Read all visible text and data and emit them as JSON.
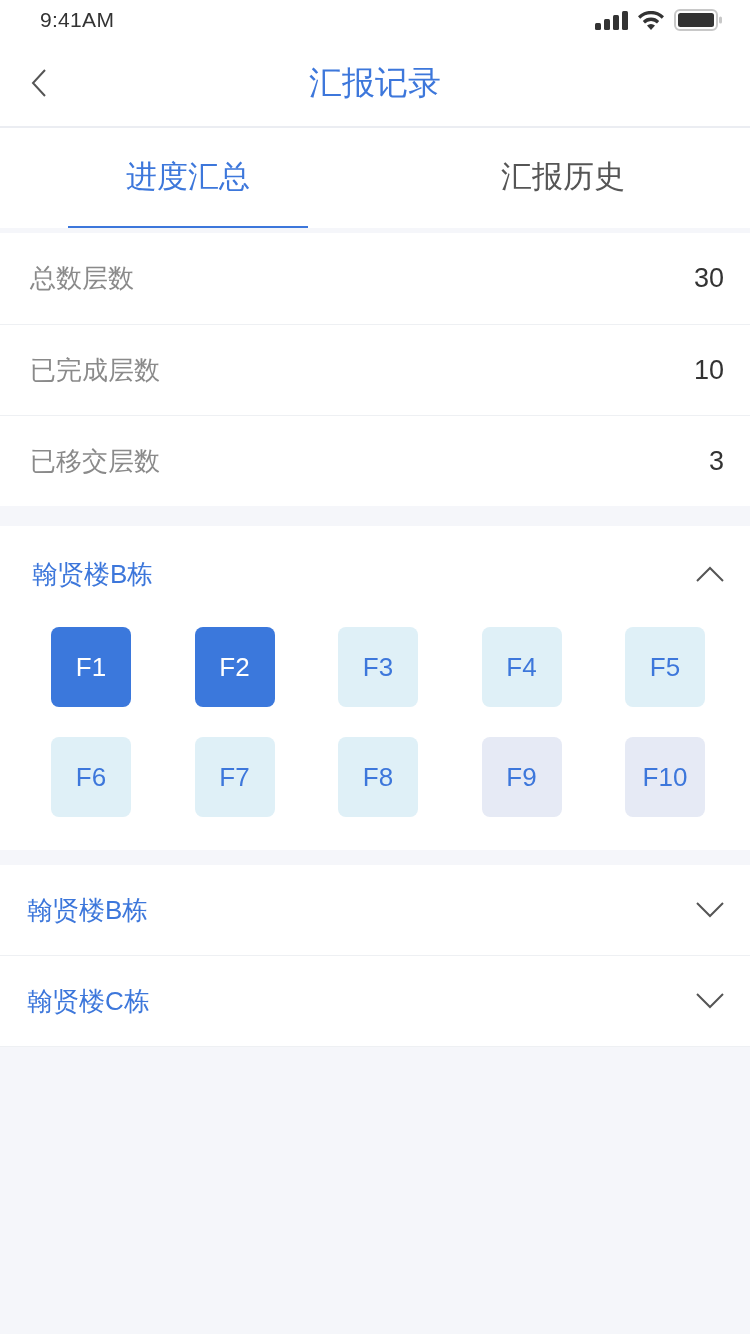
{
  "status_bar": {
    "time": "9:41AM"
  },
  "nav": {
    "title": "汇报记录"
  },
  "tabs": [
    {
      "label": "进度汇总",
      "selected": true
    },
    {
      "label": "汇报历史",
      "selected": false
    }
  ],
  "stats": [
    {
      "label": "总数层数",
      "value": "30"
    },
    {
      "label": "已完成层数",
      "value": "10"
    },
    {
      "label": "已移交层数",
      "value": "3"
    }
  ],
  "buildings": [
    {
      "name": "翰贤楼B栋",
      "expanded": true,
      "floors": [
        {
          "label": "F1",
          "color": "#3b78dc"
        },
        {
          "label": "F2",
          "color": "#3b78dc"
        },
        {
          "label": "F3",
          "color": "#dff0f7"
        },
        {
          "label": "F4",
          "color": "#dff0f7"
        },
        {
          "label": "F5",
          "color": "#dff0f7"
        },
        {
          "label": "F6",
          "color": "#dff0f7"
        },
        {
          "label": "F7",
          "color": "#dff0f7"
        },
        {
          "label": "F8",
          "color": "#dff0f7"
        },
        {
          "label": "F9",
          "color": "#e6eaf5"
        },
        {
          "label": "F10",
          "color": "#e6eaf5"
        }
      ]
    },
    {
      "name": "翰贤楼B栋",
      "expanded": false
    },
    {
      "name": "翰贤楼C栋",
      "expanded": false
    }
  ]
}
